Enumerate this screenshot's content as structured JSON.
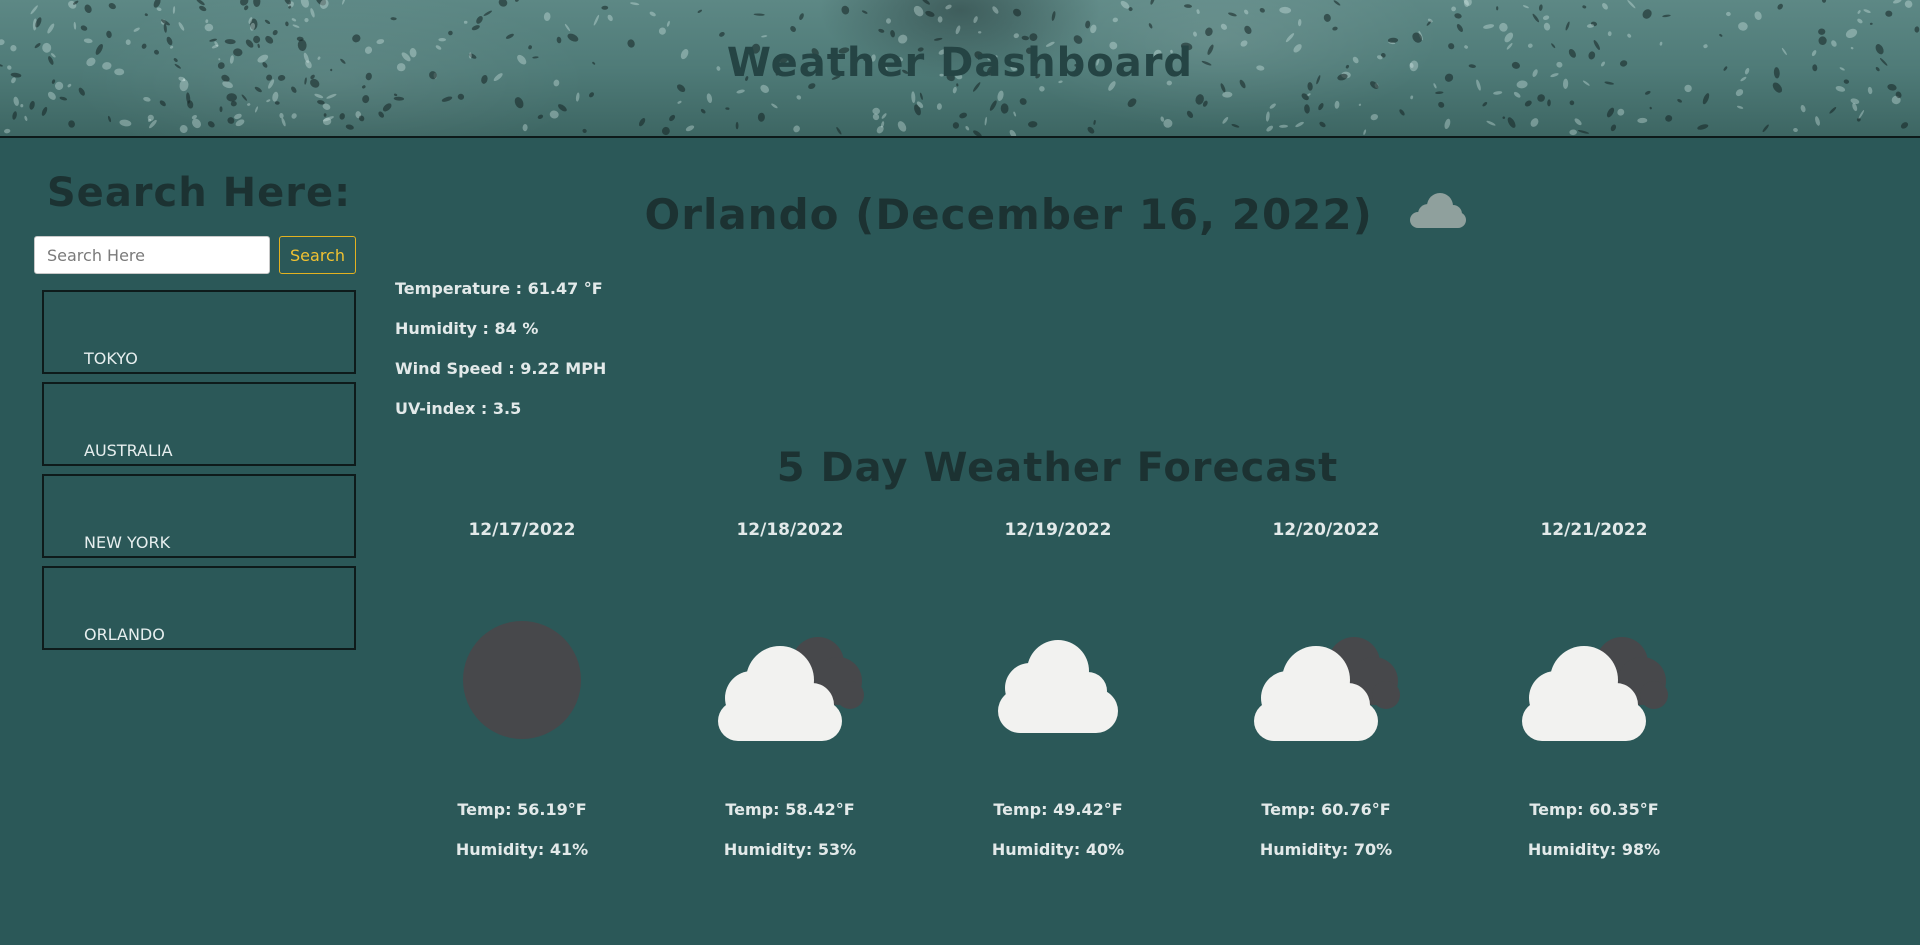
{
  "header": {
    "title": "Weather Dashboard"
  },
  "sidebar": {
    "title": "Search Here:",
    "search": {
      "placeholder": "Search Here",
      "value": "",
      "button_label": "Search"
    },
    "history": [
      "TOKYO",
      "AUSTRALIA",
      "NEW YORK",
      "ORLANDO"
    ]
  },
  "current": {
    "title": "Orlando (December 16, 2022)",
    "icon": "cloud-icon",
    "temperature": "Temperature : 61.47 °F",
    "humidity": "Humidity : 84 %",
    "wind": "Wind Speed : 9.22 MPH",
    "uv": "UV-index : 3.5"
  },
  "forecast": {
    "title": "5 Day Weather Forecast",
    "days": [
      {
        "date": "12/17/2022",
        "icon": "night-clear-icon",
        "temp": "Temp: 56.19°F",
        "humidity": "Humidity: 41%"
      },
      {
        "date": "12/18/2022",
        "icon": "cloudy-night-icon",
        "temp": "Temp: 58.42°F",
        "humidity": "Humidity: 53%"
      },
      {
        "date": "12/19/2022",
        "icon": "cloud-icon",
        "temp": "Temp: 49.42°F",
        "humidity": "Humidity: 40%"
      },
      {
        "date": "12/20/2022",
        "icon": "cloudy-night-icon",
        "temp": "Temp: 60.76°F",
        "humidity": "Humidity: 70%"
      },
      {
        "date": "12/21/2022",
        "icon": "cloudy-night-icon",
        "temp": "Temp: 60.35°F",
        "humidity": "Humidity: 98%"
      }
    ]
  },
  "colors": {
    "background": "#2b5858",
    "heading": "#1c3232",
    "text": "#e2e9e9",
    "accent": "#f1c232",
    "cloud": "#f2f2f0",
    "moon": "#47484b"
  }
}
